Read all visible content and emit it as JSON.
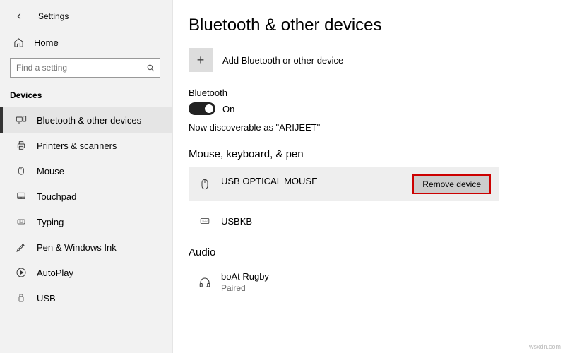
{
  "window": {
    "title": "Settings"
  },
  "home": {
    "label": "Home"
  },
  "search": {
    "placeholder": "Find a setting"
  },
  "sidebar": {
    "section": "Devices",
    "items": [
      {
        "label": "Bluetooth & other devices"
      },
      {
        "label": "Printers & scanners"
      },
      {
        "label": "Mouse"
      },
      {
        "label": "Touchpad"
      },
      {
        "label": "Typing"
      },
      {
        "label": "Pen & Windows Ink"
      },
      {
        "label": "AutoPlay"
      },
      {
        "label": "USB"
      }
    ]
  },
  "page": {
    "title": "Bluetooth & other devices",
    "add_label": "Add Bluetooth or other device",
    "bt_label": "Bluetooth",
    "bt_state": "On",
    "status": "Now discoverable as \"ARIJEET\"",
    "group_mouse": "Mouse, keyboard, & pen",
    "devices": {
      "usb_mouse": {
        "name": "USB OPTICAL MOUSE"
      },
      "usbkb": {
        "name": "USBKB"
      }
    },
    "remove_label": "Remove device",
    "group_audio": "Audio",
    "audio_device": {
      "name": "boAt Rugby",
      "status": "Paired"
    }
  },
  "watermark": "wsxdn.com"
}
